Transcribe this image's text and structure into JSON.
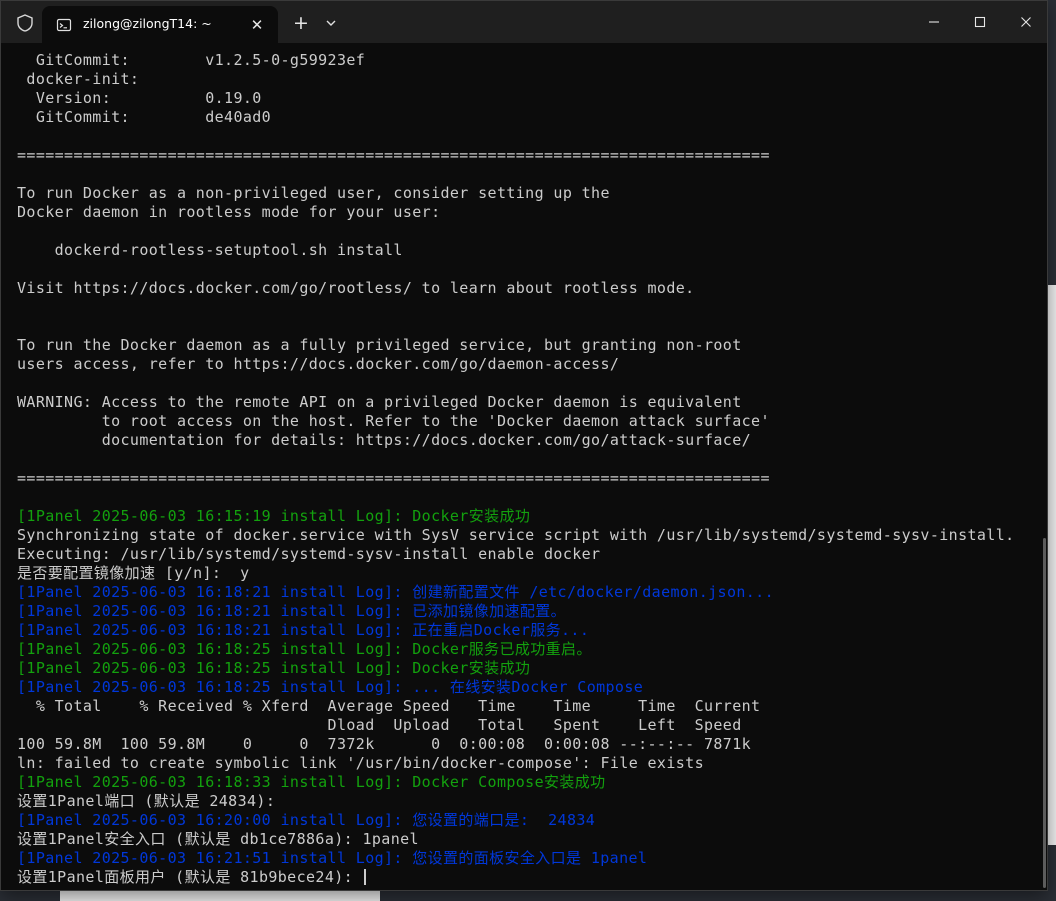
{
  "window": {
    "tab_title": "zilong@zilongT14: ~",
    "colors": {
      "background": "#0c0c0c",
      "text": "#cccccc",
      "log_green": "#13a10e",
      "log_blue": "#0037da",
      "titlebar": "#1f1f1f"
    },
    "icons": [
      "shield-icon",
      "terminal-icon",
      "close-icon",
      "plus-icon",
      "chevron-down-icon",
      "minimize-icon",
      "maximize-icon",
      "close-window-icon"
    ]
  },
  "terminal": {
    "lines": [
      {
        "text": "  GitCommit:        v1.2.5-0-g59923ef",
        "color": "default"
      },
      {
        "text": " docker-init:",
        "color": "default"
      },
      {
        "text": "  Version:          0.19.0",
        "color": "default"
      },
      {
        "text": "  GitCommit:        de40ad0",
        "color": "default"
      },
      {
        "text": "",
        "color": "default"
      },
      {
        "text": "================================================================================",
        "color": "default"
      },
      {
        "text": "",
        "color": "default"
      },
      {
        "text": "To run Docker as a non-privileged user, consider setting up the",
        "color": "default"
      },
      {
        "text": "Docker daemon in rootless mode for your user:",
        "color": "default"
      },
      {
        "text": "",
        "color": "default"
      },
      {
        "text": "    dockerd-rootless-setuptool.sh install",
        "color": "default"
      },
      {
        "text": "",
        "color": "default"
      },
      {
        "text": "Visit https://docs.docker.com/go/rootless/ to learn about rootless mode.",
        "color": "default"
      },
      {
        "text": "",
        "color": "default"
      },
      {
        "text": "",
        "color": "default"
      },
      {
        "text": "To run the Docker daemon as a fully privileged service, but granting non-root",
        "color": "default"
      },
      {
        "text": "users access, refer to https://docs.docker.com/go/daemon-access/",
        "color": "default"
      },
      {
        "text": "",
        "color": "default"
      },
      {
        "text": "WARNING: Access to the remote API on a privileged Docker daemon is equivalent",
        "color": "default"
      },
      {
        "text": "         to root access on the host. Refer to the 'Docker daemon attack surface'",
        "color": "default"
      },
      {
        "text": "         documentation for details: https://docs.docker.com/go/attack-surface/",
        "color": "default"
      },
      {
        "text": "",
        "color": "default"
      },
      {
        "text": "================================================================================",
        "color": "default"
      },
      {
        "text": "",
        "color": "default"
      },
      {
        "text": "[1Panel 2025-06-03 16:15:19 install Log]: Docker安装成功",
        "color": "green"
      },
      {
        "text": "Synchronizing state of docker.service with SysV service script with /usr/lib/systemd/systemd-sysv-install.",
        "color": "default"
      },
      {
        "text": "Executing: /usr/lib/systemd/systemd-sysv-install enable docker",
        "color": "default"
      },
      {
        "text": "是否要配置镜像加速 [y/n]:  y",
        "color": "default"
      },
      {
        "text": "[1Panel 2025-06-03 16:18:21 install Log]: 创建新配置文件 /etc/docker/daemon.json...",
        "color": "blue"
      },
      {
        "text": "[1Panel 2025-06-03 16:18:21 install Log]: 已添加镜像加速配置。",
        "color": "blue"
      },
      {
        "text": "[1Panel 2025-06-03 16:18:21 install Log]: 正在重启Docker服务...",
        "color": "blue"
      },
      {
        "text": "[1Panel 2025-06-03 16:18:25 install Log]: Docker服务已成功重启。",
        "color": "green"
      },
      {
        "text": "[1Panel 2025-06-03 16:18:25 install Log]: Docker安装成功",
        "color": "green"
      },
      {
        "text": "[1Panel 2025-06-03 16:18:25 install Log]: ... 在线安装Docker Compose",
        "color": "blue"
      },
      {
        "text": "  % Total    % Received % Xferd  Average Speed   Time    Time     Time  Current",
        "color": "default"
      },
      {
        "text": "                                 Dload  Upload   Total   Spent    Left  Speed",
        "color": "default"
      },
      {
        "text": "100 59.8M  100 59.8M    0     0  7372k      0  0:00:08  0:00:08 --:--:-- 7871k",
        "color": "default"
      },
      {
        "text": "ln: failed to create symbolic link '/usr/bin/docker-compose': File exists",
        "color": "default"
      },
      {
        "text": "[1Panel 2025-06-03 16:18:33 install Log]: Docker Compose安装成功",
        "color": "green"
      },
      {
        "text": "设置1Panel端口 (默认是 24834):",
        "color": "default"
      },
      {
        "text": "[1Panel 2025-06-03 16:20:00 install Log]: 您设置的端口是:  24834",
        "color": "blue"
      },
      {
        "text": "设置1Panel安全入口 (默认是 db1ce7886a): 1panel",
        "color": "default"
      },
      {
        "text": "[1Panel 2025-06-03 16:21:51 install Log]: 您设置的面板安全入口是 1panel",
        "color": "blue"
      },
      {
        "text": "设置1Panel面板用户 (默认是 81b9bece24): ",
        "color": "default",
        "cursor": true
      }
    ]
  }
}
